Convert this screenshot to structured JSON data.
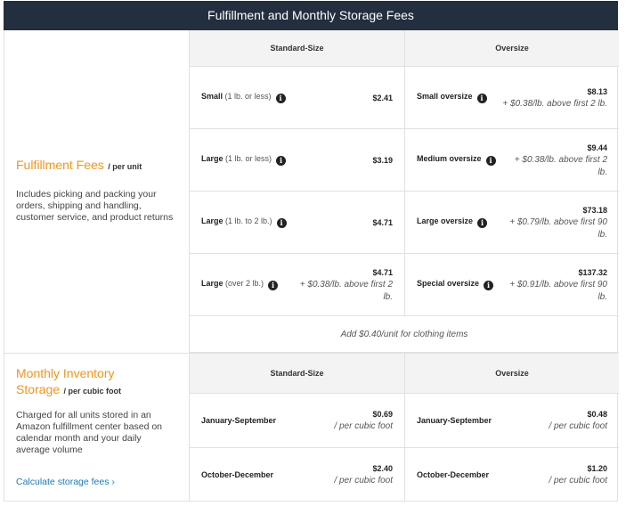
{
  "title": "Fulfillment and Monthly Storage Fees",
  "fulfillment": {
    "heading": "Fulfillment Fees",
    "per": "/ per unit",
    "description": "Includes picking and packing your orders, shipping and handling, customer service, and product returns",
    "col_standard": "Standard-Size",
    "col_oversize": "Oversize",
    "rows": [
      {
        "std_name": "Small",
        "std_sub": "(1 lb. or less)",
        "std_price": "$2.41",
        "std_extra": "",
        "over_name": "Small oversize",
        "over_price": "$8.13",
        "over_extra": "+ $0.38/lb. above first 2 lb."
      },
      {
        "std_name": "Large",
        "std_sub": "(1 lb. or less)",
        "std_price": "$3.19",
        "std_extra": "",
        "over_name": "Medium oversize",
        "over_price": "$9.44",
        "over_extra": "+ $0.38/lb. above first 2 lb."
      },
      {
        "std_name": "Large",
        "std_sub": "(1 lb. to 2 lb.)",
        "std_price": "$4.71",
        "std_extra": "",
        "over_name": "Large oversize",
        "over_price": "$73.18",
        "over_extra": "+ $0.79/lb. above first 90 lb."
      },
      {
        "std_name": "Large",
        "std_sub": "(over 2 lb.)",
        "std_price": "$4.71",
        "std_extra": "+ $0.38/lb. above first 2 lb.",
        "over_name": "Special oversize",
        "over_price": "$137.32",
        "over_extra": "+ $0.91/lb. above first 90 lb."
      }
    ],
    "note": "Add $0.40/unit for clothing items"
  },
  "storage": {
    "heading_line1": "Monthly Inventory",
    "heading_line2": "Storage",
    "per": "/ per cubic foot",
    "description": "Charged for all units stored in an Amazon fulfillment center based on calendar month and your daily average volume",
    "link": "Calculate storage fees ›",
    "col_standard": "Standard-Size",
    "col_oversize": "Oversize",
    "rows": [
      {
        "std_name": "January-September",
        "std_price": "$0.69",
        "std_extra": "/ per cubic foot",
        "over_name": "January-September",
        "over_price": "$0.48",
        "over_extra": "/ per cubic foot"
      },
      {
        "std_name": "October-December",
        "std_price": "$2.40",
        "std_extra": "/ per cubic foot",
        "over_name": "October-December",
        "over_price": "$1.20",
        "over_extra": "/ per cubic foot"
      }
    ]
  },
  "icons": {
    "info": "info-icon"
  }
}
